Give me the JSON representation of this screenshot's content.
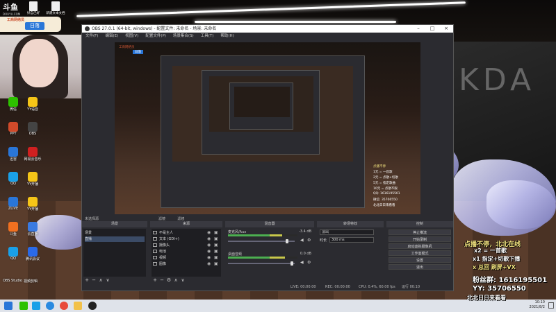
{
  "desktop": {
    "logo_text": "斗鱼",
    "logo_sub": "DOUYU.COM",
    "files": [
      {
        "label": "好自己好"
      },
      {
        "label": "新建文本文档"
      }
    ],
    "banner_top": "工商网络员",
    "banner_badge": "日落",
    "icons": [
      {
        "label": "微信",
        "color": "#2dc100"
      },
      {
        "label": "YY语音",
        "color": "#f5c518"
      },
      {
        "label": "PPT",
        "color": "#d04a2a"
      },
      {
        "label": "OBS",
        "color": "#444444"
      },
      {
        "label": "迅雷",
        "color": "#2a76d8"
      },
      {
        "label": "网易云音乐",
        "color": "#d02020"
      },
      {
        "label": "QQ",
        "color": "#1aa0e8"
      },
      {
        "label": "YY开播",
        "color": "#f5c518"
      },
      {
        "label": "ZLIVE",
        "color": "#2a76d8"
      },
      {
        "label": "YY开播",
        "color": "#f5c518"
      },
      {
        "label": "斗鱼",
        "color": "#f07020"
      },
      {
        "label": "云直播",
        "color": "#3a7ae0"
      },
      {
        "label": "QQ",
        "color": "#1aa0e8"
      },
      {
        "label": "腾讯会议",
        "color": "#2a6ae8"
      }
    ],
    "bottom_labels": [
      "OBS Studio",
      "视频剪辑"
    ]
  },
  "obs": {
    "title": "OBS 27.0.1 (64-bit, windows) - 配置文件: 未命名 - 场景: 未命名",
    "menu": [
      "文件(F)",
      "编辑(E)",
      "视图(V)",
      "配置文件(P)",
      "场景集合(S)",
      "工具(T)",
      "帮助(H)"
    ],
    "preview_overlay": {
      "top_left": "工商网络员",
      "badge": "日落",
      "lines": [
        "点播不停",
        "1元 = 一首歌",
        "2元 = 点歌+切歌",
        "5元 = 指定歌曲",
        "10元 = 点歌不限",
        "QQ: 1616195501",
        "微信: 35706550",
        "北北日日来看看"
      ]
    },
    "bottom_toolbar": [
      "滤镜",
      "滤镜"
    ],
    "panels": {
      "scenes": {
        "header": "场景",
        "items": [
          "场景",
          "直播"
        ],
        "selected": 1,
        "tools": [
          "+",
          "−",
          "∧",
          "∨"
        ]
      },
      "sources": {
        "header": "来源",
        "items": [
          "不是主人",
          "文本 (GDI+)",
          "摄像头",
          "电池",
          "视频",
          "图像"
        ],
        "tools": [
          "+",
          "−",
          "⚙",
          "∧",
          "∨"
        ]
      },
      "mixer": {
        "header": "混音器",
        "channels": [
          {
            "name": "麦克风/Aux",
            "db": "-3.4 dB",
            "level": 0.78,
            "fader": 0.9
          },
          {
            "name": "桌面音频",
            "db": "0.0 dB",
            "level": 0.82,
            "fader": 0.98
          }
        ]
      },
      "transitions": {
        "header": "转场特效",
        "type": "淡出",
        "duration_label": "时长",
        "duration_value": "300 ms"
      },
      "controls": {
        "header": "控制",
        "buttons": [
          "停止推流",
          "开始录制",
          "启动虚拟摄像机",
          "工作室模式",
          "设置",
          "退出"
        ]
      }
    },
    "scene_label": "未选择源",
    "status": {
      "live": "LIVE: 00:00:00",
      "rec": "REC: 00:00:00",
      "cpu": "CPU: 0.4%, 60.00 fps",
      "net": "kb/s: 0",
      "extra": "运行 00:10"
    }
  },
  "overlay_right": {
    "lines": [
      {
        "text": "点播不停，北北在线",
        "color": "#f5e680"
      },
      {
        "text": "x2 = 一首歌",
        "color": "#ffffff"
      },
      {
        "text": "x1 指定+切歌下播",
        "color": "#ffffff"
      },
      {
        "text": "x 总回 刷屏+VX",
        "color": "#f5e680"
      },
      {
        "text": "粉丝群: 1616195501",
        "color": "#ffffff"
      },
      {
        "text": "YY: 35706550",
        "color": "#ffffff"
      },
      {
        "text": "北北日日来看看",
        "color": "#ffffff"
      }
    ]
  },
  "taskbar": {
    "time": "10:10",
    "date": "2021/8/2"
  }
}
